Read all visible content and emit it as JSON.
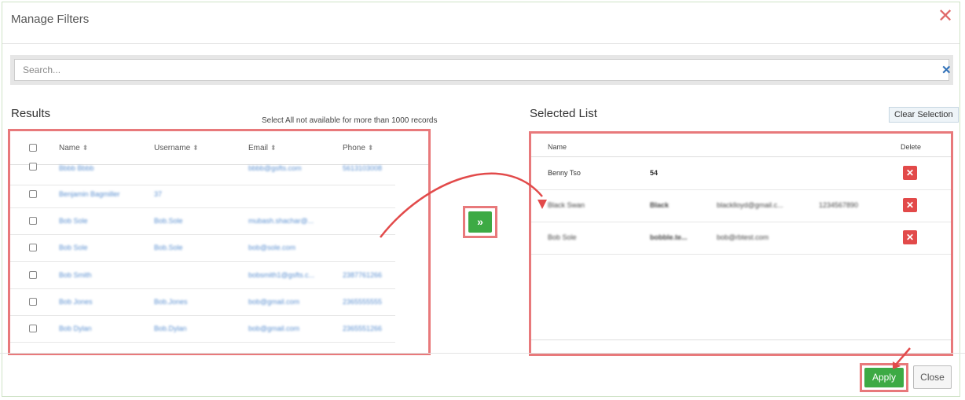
{
  "modal": {
    "title": "Manage Filters",
    "close_symbol": "✕"
  },
  "search": {
    "placeholder": "Search...",
    "clear_symbol": "✕"
  },
  "results": {
    "title": "Results",
    "note": "Select All not available for more than 1000 records",
    "columns": [
      "Name",
      "Username",
      "Email",
      "Phone"
    ],
    "rows": [
      {
        "name": "Bbbb Bbbb",
        "username": "",
        "email": "bbbb@gsfts.com",
        "phone": "5613103008"
      },
      {
        "name": "Benjamin Bagmiller",
        "username": "37",
        "email": "",
        "phone": ""
      },
      {
        "name": "Bob Sole",
        "username": "Bob.Sole",
        "email": "mubash.shachar@...",
        "phone": ""
      },
      {
        "name": "Bob Sole",
        "username": "Bob.Sole",
        "email": "bob@sole.com",
        "phone": ""
      },
      {
        "name": "Bob Smith",
        "username": "",
        "email": "bobsmith1@gsfts.c...",
        "phone": "2387761266"
      },
      {
        "name": "Bob Jones",
        "username": "Bob.Jones",
        "email": "bob@gmail.com",
        "phone": "2365555555"
      },
      {
        "name": "Bob Dylan",
        "username": "Bob.Dylan",
        "email": "bob@gmail.com",
        "phone": "2365551266"
      }
    ]
  },
  "move_button": {
    "symbol": "»"
  },
  "selected": {
    "title": "Selected List",
    "clear_label": "Clear Selection",
    "columns": {
      "name": "Name",
      "delete": "Delete"
    },
    "rows": [
      {
        "name": "Benny Tso",
        "col2": "54",
        "col3": "",
        "col4": ""
      },
      {
        "name": "Black Swan",
        "col2": "Black",
        "col3": "blacklloyd@gmail.c...",
        "col4": "1234567890"
      },
      {
        "name": "Bob Sole",
        "col2": "bobble.te...",
        "col3": "bob@rbtest.com",
        "col4": ""
      }
    ],
    "delete_symbol": "✕"
  },
  "footer": {
    "apply_label": "Apply",
    "close_label": "Close"
  },
  "colors": {
    "accent_green": "#3daa44",
    "highlight_red": "#e8797b",
    "delete_red": "#e24a4a",
    "link_blue": "#5a8fd0"
  }
}
